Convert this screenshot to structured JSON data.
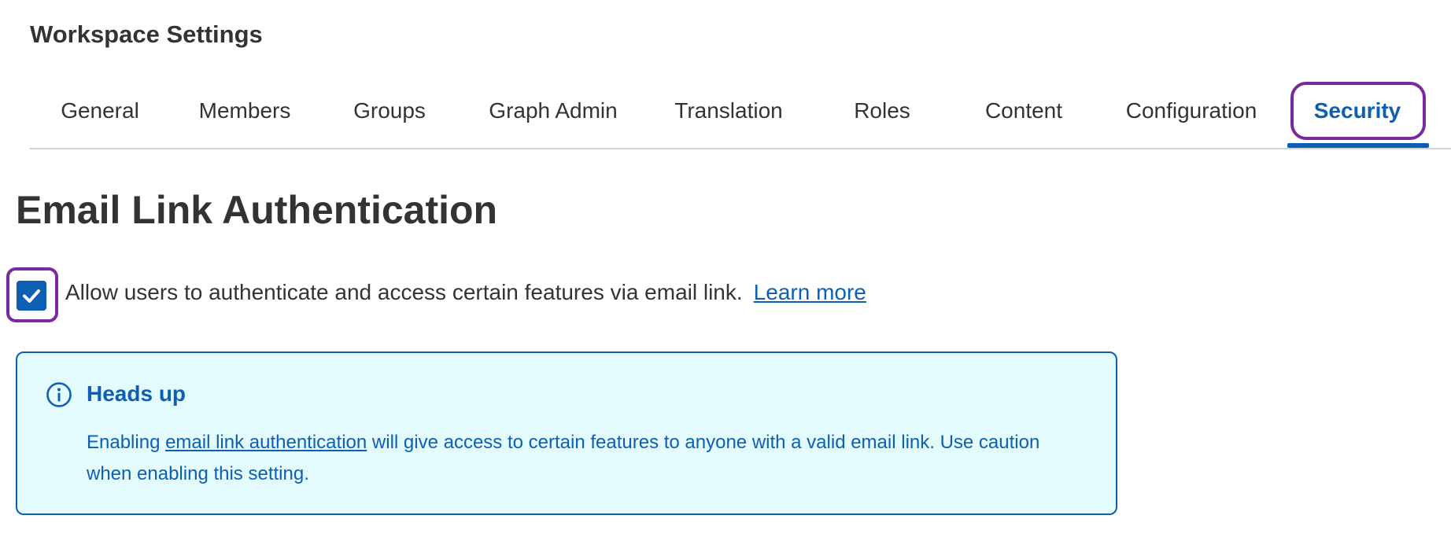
{
  "page": {
    "title": "Workspace Settings"
  },
  "tabs": [
    {
      "label": "General",
      "active": false
    },
    {
      "label": "Members",
      "active": false
    },
    {
      "label": "Groups",
      "active": false
    },
    {
      "label": "Graph Admin",
      "active": false
    },
    {
      "label": "Translation",
      "active": false
    },
    {
      "label": "Roles",
      "active": false
    },
    {
      "label": "Content",
      "active": false
    },
    {
      "label": "Configuration",
      "active": false
    },
    {
      "label": "Security",
      "active": true
    }
  ],
  "section": {
    "heading": "Email Link Authentication",
    "option": {
      "checked": true,
      "label": "Allow users to authenticate and access certain features via email link.",
      "link": "Learn more"
    }
  },
  "alert": {
    "icon": "info-icon",
    "title": "Heads up",
    "body_prefix": "Enabling ",
    "body_link": "email link authentication",
    "body_suffix": " will give access to certain features to anyone with a valid email link. Use caution when enabling this setting."
  },
  "colors": {
    "accent": "#0d5fb3",
    "focus_ring": "#7a2a9a",
    "alert_background": "#e3fbfc",
    "text": "#333333"
  }
}
